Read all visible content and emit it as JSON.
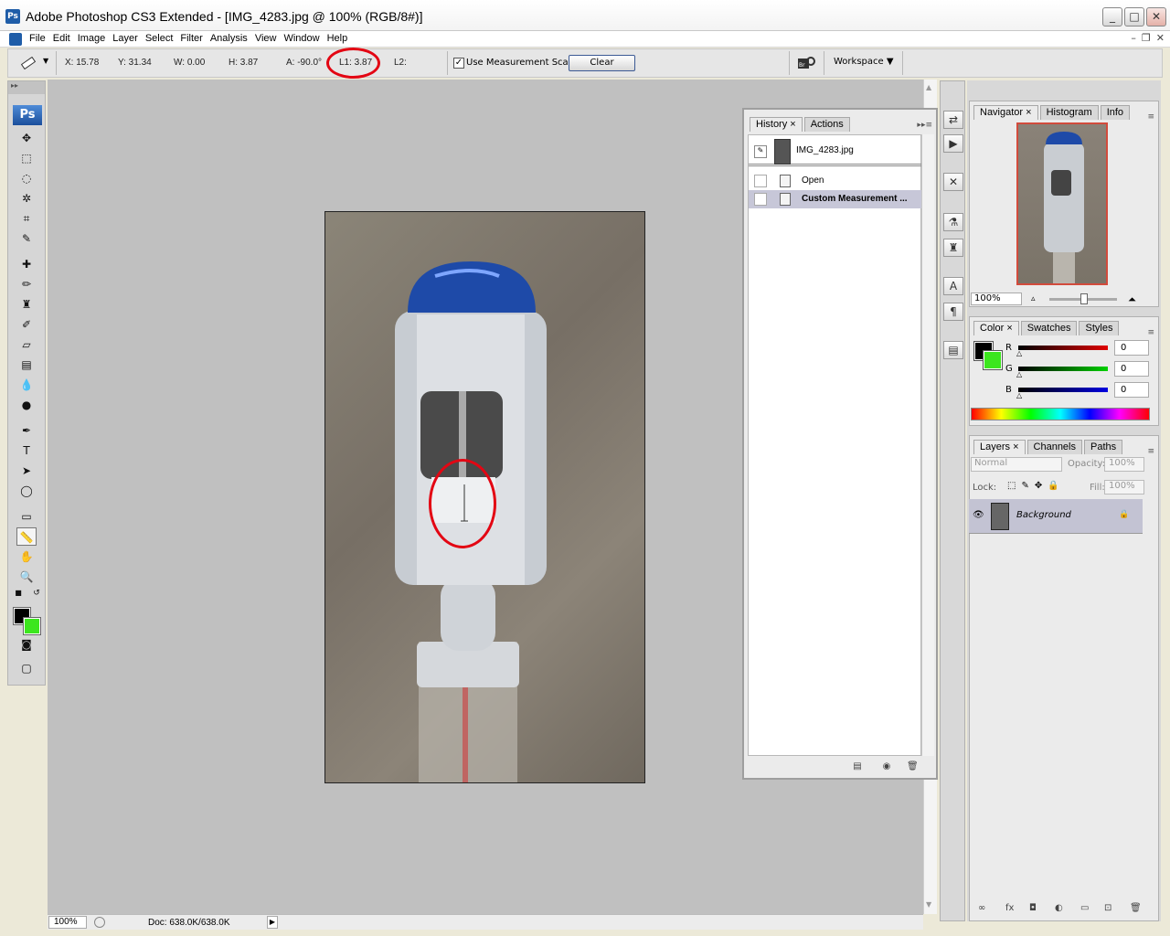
{
  "window": {
    "title": "Adobe Photoshop CS3 Extended - [IMG_4283.jpg @ 100% (RGB/8#)]",
    "app_icon": "Ps",
    "buttons": [
      "minimize-icon",
      "maximize-icon",
      "close-icon"
    ]
  },
  "menu": {
    "items": [
      "File",
      "Edit",
      "Image",
      "Layer",
      "Select",
      "Filter",
      "Analysis",
      "View",
      "Window",
      "Help"
    ]
  },
  "options": {
    "x": "X: 15.78",
    "y": "Y: 31.34",
    "w": "W: 0.00",
    "h": "H: 3.87",
    "a": "A: -90.0°",
    "l1": "L1: 3.87",
    "l2": "L2:",
    "use_measurement_scale_label": "Use Measurement Scale",
    "use_measurement_scale_checked": true,
    "clear_label": "Clear",
    "workspace_label": "Workspace"
  },
  "toolbox": {
    "logo": "Ps",
    "foreground_color": "#000000",
    "background_color": "#3ce61e"
  },
  "status": {
    "zoom": "100%",
    "doc": "Doc: 638.0K/638.0K"
  },
  "history": {
    "tabs": [
      "History",
      "Actions"
    ],
    "snapshot": "IMG_4283.jpg",
    "steps": [
      "Open",
      "Custom Measurement ..."
    ],
    "selected_step": 1
  },
  "navigator": {
    "tabs": [
      "Navigator",
      "Histogram",
      "Info"
    ],
    "zoom": "100%"
  },
  "color_panel": {
    "tabs": [
      "Color",
      "Swatches",
      "Styles"
    ],
    "r_label": "R",
    "g_label": "G",
    "b_label": "B",
    "r": "0",
    "g": "0",
    "b": "0"
  },
  "layers_panel": {
    "tabs": [
      "Layers",
      "Channels",
      "Paths"
    ],
    "blend_mode": "Normal",
    "opacity_label": "Opacity:",
    "opacity": "100%",
    "lock_label": "Lock:",
    "fill_label": "Fill:",
    "fill": "100%",
    "layers": [
      "Background"
    ]
  },
  "accent_colors": {
    "annotation_red": "#e30613",
    "ps_blue": "#1f5da8"
  }
}
